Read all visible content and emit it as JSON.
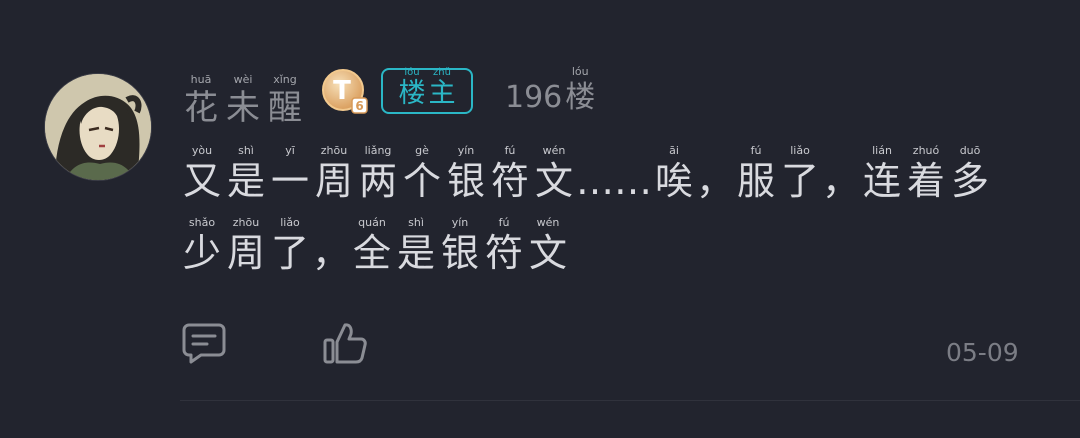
{
  "post": {
    "author": {
      "name": [
        {
          "hz": "花",
          "py": "huā"
        },
        {
          "hz": "未",
          "py": "wèi"
        },
        {
          "hz": "醒",
          "py": "xǐng"
        }
      ],
      "avatar_icon": "avatar-girl-portrait",
      "level_badge": "T",
      "level_badge_sub": "6",
      "owner_tag": [
        {
          "hz": "楼",
          "py": "lóu"
        },
        {
          "hz": "主",
          "py": "zhǔ"
        }
      ]
    },
    "floor": {
      "number": "196",
      "unit": {
        "hz": "楼",
        "py": "lóu"
      }
    },
    "content": {
      "line1": [
        {
          "hz": "又",
          "py": "yòu"
        },
        {
          "hz": "是",
          "py": "shì"
        },
        {
          "hz": "一",
          "py": "yī"
        },
        {
          "hz": "周",
          "py": "zhōu"
        },
        {
          "hz": "两",
          "py": "liǎng"
        },
        {
          "hz": "个",
          "py": "gè"
        },
        {
          "hz": "银",
          "py": "yín"
        },
        {
          "hz": "符",
          "py": "fú"
        },
        {
          "hz": "文",
          "py": "wén"
        },
        {
          "punct": "……"
        },
        {
          "hz": "唉",
          "py": "āi"
        },
        {
          "punct": "，"
        },
        {
          "hz": "服",
          "py": "fú"
        },
        {
          "hz": "了",
          "py": "liǎo"
        },
        {
          "punct": "，"
        },
        {
          "hz": "连",
          "py": "lián"
        },
        {
          "hz": "着",
          "py": "zhuó"
        },
        {
          "hz": "多",
          "py": "duō"
        }
      ],
      "line2": [
        {
          "hz": "少",
          "py": "shǎo"
        },
        {
          "hz": "周",
          "py": "zhōu"
        },
        {
          "hz": "了",
          "py": "liǎo"
        },
        {
          "punct": "，"
        },
        {
          "hz": "全",
          "py": "quán"
        },
        {
          "hz": "是",
          "py": "shì"
        },
        {
          "hz": "银",
          "py": "yín"
        },
        {
          "hz": "符",
          "py": "fú"
        },
        {
          "hz": "文",
          "py": "wén"
        }
      ]
    },
    "actions": {
      "reply_icon": "comment-icon",
      "like_icon": "thumbs-up-icon"
    },
    "date": "05-09"
  },
  "colors": {
    "background": "#22242e",
    "accent": "#2bb7c6",
    "muted": "#8b8d94",
    "text": "#d9dadf"
  }
}
